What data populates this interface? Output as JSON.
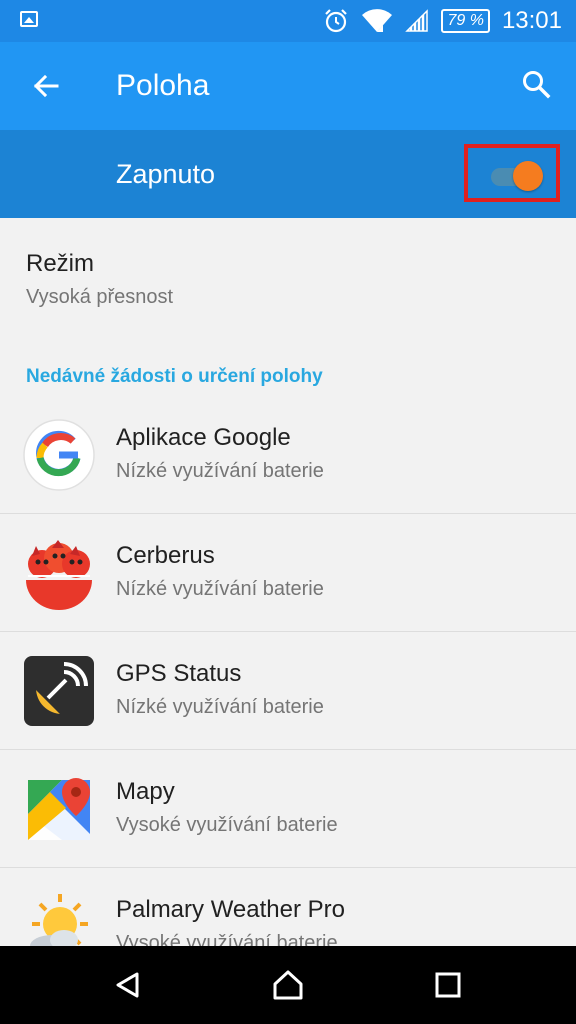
{
  "status_bar": {
    "battery": "79 %",
    "time": "13:01",
    "icons": [
      "gallery-icon",
      "alarm-icon",
      "wifi-icon",
      "signal-icon",
      "battery-icon"
    ]
  },
  "app_bar": {
    "title": "Poloha",
    "icons": [
      "back-arrow-icon",
      "search-icon"
    ]
  },
  "master_switch": {
    "label": "Zapnuto",
    "state": "on",
    "accent": "#f57c1f"
  },
  "mode": {
    "title": "Režim",
    "value": "Vysoká přesnost"
  },
  "recent_requests": {
    "header": "Nedávné žádosti o určení polohy",
    "items": [
      {
        "name": "Aplikace Google",
        "usage": "Nízké využívání baterie",
        "icon": "google-app-icon"
      },
      {
        "name": "Cerberus",
        "usage": "Nízké využívání baterie",
        "icon": "cerberus-icon"
      },
      {
        "name": "GPS Status",
        "usage": "Nízké využívání baterie",
        "icon": "gps-status-icon"
      },
      {
        "name": "Mapy",
        "usage": "Vysoké využívání baterie",
        "icon": "maps-icon"
      },
      {
        "name": "Palmary Weather Pro",
        "usage": "Vysoké využívání baterie",
        "icon": "palmary-weather-icon"
      }
    ]
  },
  "colors": {
    "status_bar": "#1e88e5",
    "app_bar": "#2196f3",
    "switch_bar": "#1c83d4",
    "section_header": "#29a8e0",
    "highlight": "#e0201f"
  },
  "nav_bar": {
    "icons": [
      "back-triangle-icon",
      "home-icon",
      "recents-icon"
    ]
  }
}
